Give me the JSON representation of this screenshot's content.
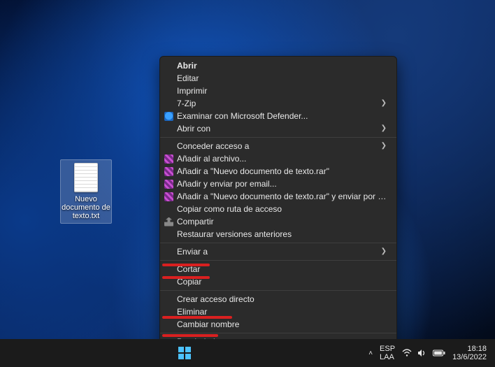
{
  "desktop": {
    "icon_label": "Nuevo documento de texto.txt"
  },
  "context_menu": {
    "open": "Abrir",
    "edit": "Editar",
    "print": "Imprimir",
    "sevenzip": "7-Zip",
    "defender": "Examinar con Microsoft Defender...",
    "open_with": "Abrir con",
    "give_access": "Conceder acceso a",
    "add_to_archive": "Añadir al archivo...",
    "add_to_rar": "Añadir a \"Nuevo documento de texto.rar\"",
    "add_and_email": "Añadir y enviar por email...",
    "add_to_rar_email": "Añadir a \"Nuevo documento de texto.rar\" y enviar por email",
    "copy_as_path": "Copiar como ruta de acceso",
    "share": "Compartir",
    "restore_prev": "Restaurar versiones anteriores",
    "send_to": "Enviar a",
    "cut": "Cortar",
    "copy": "Copiar",
    "create_shortcut": "Crear acceso directo",
    "delete": "Eliminar",
    "rename": "Cambiar nombre",
    "properties": "Propiedades"
  },
  "taskbar": {
    "lang1": "ESP",
    "lang2": "LAA",
    "time": "18:18",
    "date": "13/6/2022"
  }
}
